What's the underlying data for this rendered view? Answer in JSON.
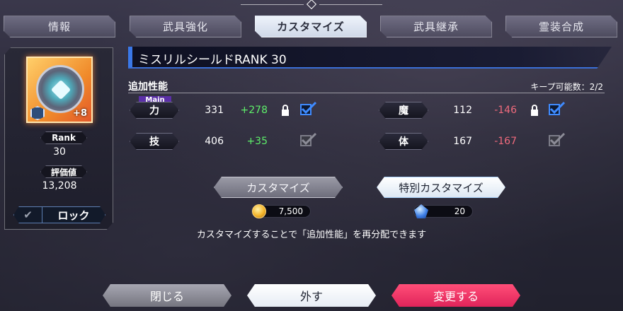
{
  "tabs": [
    "情報",
    "武具強化",
    "カスタマイズ",
    "武具継承",
    "霊装合成"
  ],
  "active_tab": 2,
  "item": {
    "name": "ミスリルシールドRANK 30",
    "plus_level": "+8",
    "rank_label": "Rank",
    "rank_value": "30",
    "rating_label": "評価値",
    "rating_value": "13,208",
    "lock_label": "ロック"
  },
  "section": {
    "title": "追加性能",
    "keep_count": "キープ可能数：2/2",
    "main_tag": "Main"
  },
  "stats": [
    {
      "label": "力",
      "value": "331",
      "delta": "+278",
      "delta_sign": "pos",
      "locked": true,
      "checked": true
    },
    {
      "label": "魔",
      "value": "112",
      "delta": "-146",
      "delta_sign": "neg",
      "locked": true,
      "checked": true
    },
    {
      "label": "技",
      "value": "406",
      "delta": "+35",
      "delta_sign": "pos",
      "locked": false,
      "checked": false
    },
    {
      "label": "体",
      "value": "167",
      "delta": "-167",
      "delta_sign": "neg",
      "locked": false,
      "checked": false
    }
  ],
  "actions": {
    "customize_label": "カスタマイズ",
    "customize_cost": "7,500",
    "special_label": "特別カスタマイズ",
    "special_cost": "20",
    "note": "カスタマイズすることで「追加性能」を再分配できます"
  },
  "bottom": {
    "close": "閉じる",
    "remove": "外す",
    "change": "変更する"
  }
}
